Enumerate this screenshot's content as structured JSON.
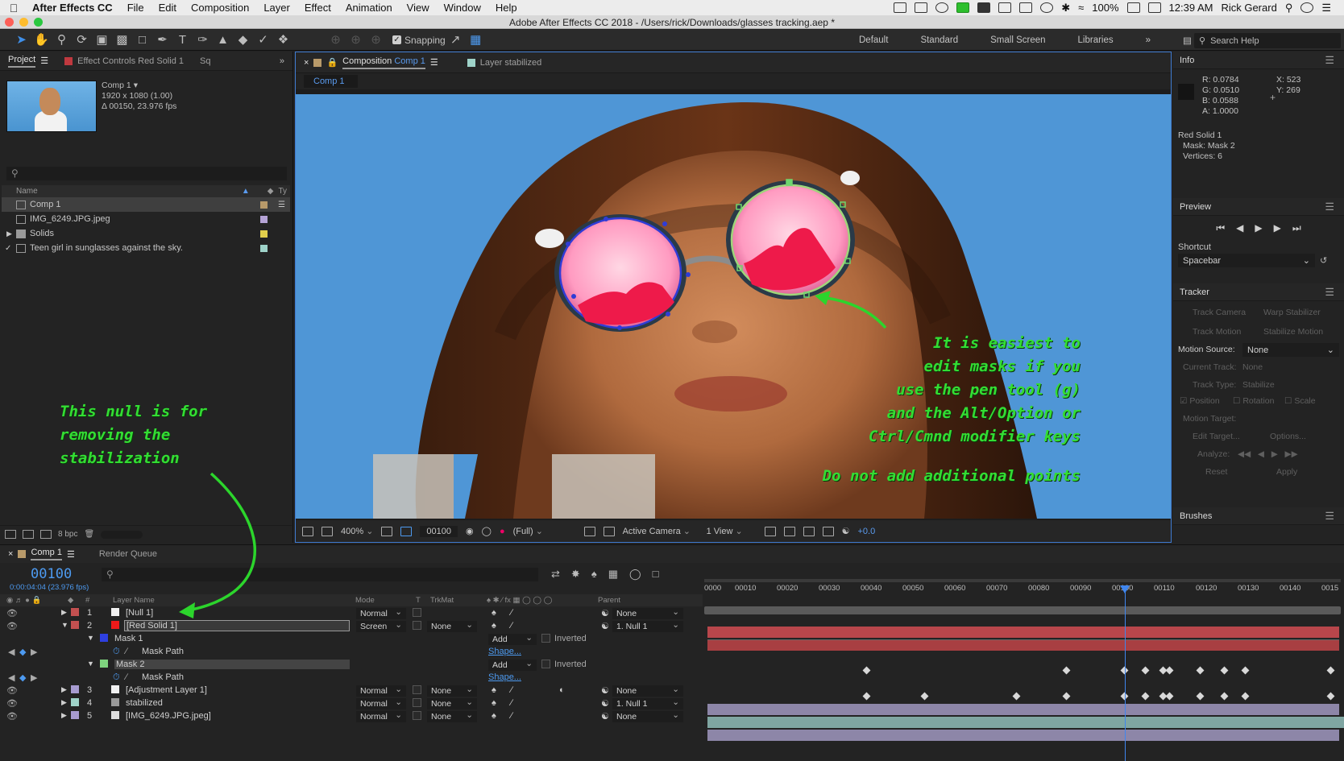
{
  "menubar": {
    "app": "After Effects CC",
    "items": [
      "File",
      "Edit",
      "Composition",
      "Layer",
      "Effect",
      "Animation",
      "View",
      "Window",
      "Help"
    ],
    "battery": "100%",
    "time": "12:39 AM",
    "user": "Rick Gerard"
  },
  "window": {
    "title": "Adobe After Effects CC 2018 - /Users/rick/Downloads/glasses tracking.aep *"
  },
  "toolbar": {
    "snapping_label": "Snapping",
    "workspaces": [
      "Default",
      "Standard",
      "Small Screen",
      "Libraries"
    ],
    "search_help": "Search Help"
  },
  "project": {
    "tab_project": "Project",
    "tab_effect": "Effect Controls Red Solid 1",
    "tab_extra": "Sq",
    "comp_name": "Comp 1",
    "comp_size": "1920 x 1080 (1.00)",
    "comp_duration": "Δ 00150, 23.976 fps",
    "col_name": "Name",
    "col_type": "Ty",
    "items": [
      {
        "name": "Comp 1",
        "color": "#b89a6a",
        "selected": true
      },
      {
        "name": "IMG_6249.JPG.jpeg",
        "color": "#b5a3d6"
      },
      {
        "name": "Solids",
        "color": "#e2cf4c"
      },
      {
        "name": "Teen girl in sunglasses against the sky.",
        "color": "#9fd3c9"
      }
    ],
    "bpc": "8 bpc"
  },
  "composition": {
    "tab_comp_prefix": "Composition",
    "tab_comp_name": "Comp 1",
    "tab_layer": "Layer stabilized",
    "sub_chip": "Comp 1",
    "zoom": "400%",
    "frame": "00100",
    "resolution": "(Full)",
    "camera": "Active Camera",
    "views": "1 View",
    "exposure": "+0.0",
    "annotation_right": [
      "It is easiest to",
      "edit masks if you",
      "use the pen tool (g)",
      "and the Alt/Option or",
      "Ctrl/Cmnd modifier keys"
    ],
    "annotation_bottom": "Do not add additional points",
    "annotation_left": [
      "This null is for",
      "removing the",
      "stabilization"
    ]
  },
  "info": {
    "title": "Info",
    "r": "R: 0.0784",
    "g": "G: 0.0510",
    "b": "B: 0.0588",
    "a": "A: 1.0000",
    "x": "X: 523",
    "y": "Y: 269",
    "layer": "Red Solid 1",
    "mask": "Mask: Mask 2",
    "vertices": "Vertices: 6"
  },
  "preview": {
    "title": "Preview",
    "shortcut_label": "Shortcut",
    "shortcut_value": "Spacebar"
  },
  "tracker": {
    "title": "Tracker",
    "track_camera": "Track Camera",
    "warp_stabilizer": "Warp Stabilizer",
    "track_motion": "Track Motion",
    "stabilize_motion": "Stabilize Motion",
    "motion_source_label": "Motion Source:",
    "motion_source": "None",
    "current_track_label": "Current Track:",
    "current_track": "None",
    "track_type_label": "Track Type:",
    "track_type": "Stabilize",
    "position": "Position",
    "rotation": "Rotation",
    "scale": "Scale",
    "motion_target": "Motion Target:",
    "edit_target": "Edit Target...",
    "options": "Options...",
    "analyze": "Analyze:",
    "reset": "Reset",
    "apply": "Apply"
  },
  "brushes": {
    "title": "Brushes"
  },
  "timeline": {
    "tab_comp": "Comp 1",
    "tab_render": "Render Queue",
    "timecode": "00100",
    "timecode_sub": "0:00:04:04 (23.976 fps)",
    "col_layer": "Layer Name",
    "col_mode": "Mode",
    "col_t": "T",
    "col_trkmat": "TrkMat",
    "col_parent": "Parent",
    "ruler": [
      "0000",
      "00010",
      "00020",
      "00030",
      "00040",
      "00050",
      "00060",
      "00070",
      "00080",
      "00090",
      "00100",
      "00110",
      "00120",
      "00130",
      "00140",
      "0015"
    ],
    "layers": [
      {
        "num": "1",
        "name": "[Null 1]",
        "mode": "Normal",
        "trkmat": "",
        "parent": "None",
        "color": "#c25050"
      },
      {
        "num": "2",
        "name": "[Red Solid 1]",
        "mode": "Screen",
        "trkmat": "None",
        "parent": "1. Null 1",
        "color": "#c25050"
      },
      {
        "num": "3",
        "name": "[Adjustment Layer 1]",
        "mode": "Normal",
        "trkmat": "None",
        "parent": "None",
        "color": "#a79bd0"
      },
      {
        "num": "4",
        "name": "stabilized",
        "mode": "Normal",
        "trkmat": "None",
        "parent": "1. Null 1",
        "color": "#9fd3c9"
      },
      {
        "num": "5",
        "name": "[IMG_6249.JPG.jpeg]",
        "mode": "Normal",
        "trkmat": "None",
        "parent": "None",
        "color": "#a79bd0"
      }
    ],
    "mask1": "Mask 1",
    "mask2": "Mask 2",
    "mask_path": "Mask Path",
    "add": "Add",
    "inverted": "Inverted",
    "shape": "Shape..."
  }
}
